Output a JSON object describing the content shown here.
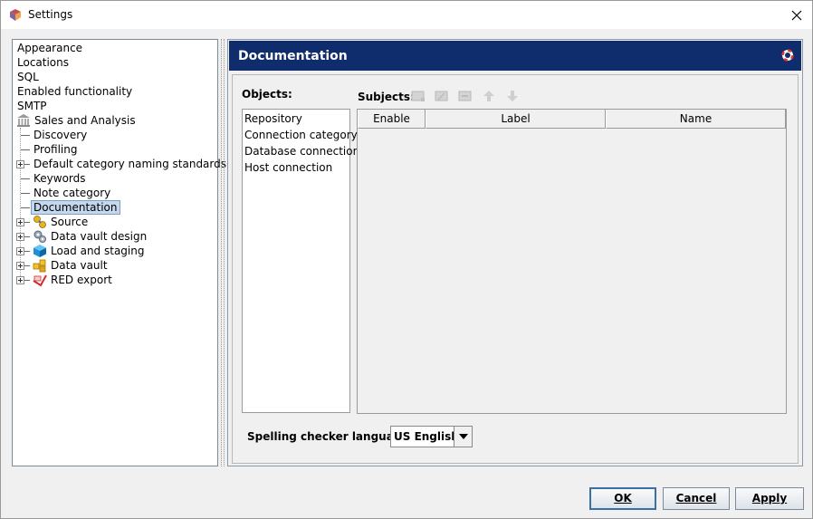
{
  "window": {
    "title": "Settings"
  },
  "tree": {
    "items": [
      {
        "label": "Appearance"
      },
      {
        "label": "Locations"
      },
      {
        "label": "SQL"
      },
      {
        "label": "Enabled functionality"
      },
      {
        "label": "SMTP"
      },
      {
        "label": "Sales and Analysis",
        "icon": "bank-icon"
      },
      {
        "label": "Discovery"
      },
      {
        "label": "Profiling"
      },
      {
        "label": "Default category naming standards"
      },
      {
        "label": "Keywords"
      },
      {
        "label": "Note category"
      },
      {
        "label": "Documentation",
        "selected": true
      },
      {
        "label": "Source",
        "icon": "source-icon"
      },
      {
        "label": "Data vault design",
        "icon": "gears-icon"
      },
      {
        "label": "Load and staging",
        "icon": "cube-icon"
      },
      {
        "label": "Data vault",
        "icon": "data-vault-icon"
      },
      {
        "label": "RED export",
        "icon": "red-export-icon"
      }
    ]
  },
  "panel": {
    "title": "Documentation",
    "help_icon": "lifebuoy-icon",
    "header_color": "#0f2c6c"
  },
  "objects": {
    "label": "Objects:",
    "items": [
      "Repository",
      "Connection category",
      "Database connection",
      "Host connection"
    ]
  },
  "subjects": {
    "label": "Subjects:",
    "toolbar": [
      "add-icon",
      "edit-icon",
      "delete-icon",
      "move-up-icon",
      "move-down-icon"
    ],
    "columns": [
      "Enable",
      "Label",
      "Name"
    ]
  },
  "spelling": {
    "label": "Spelling checker language:",
    "value": "US English"
  },
  "buttons": {
    "ok": "OK",
    "cancel": "Cancel",
    "apply": "Apply"
  }
}
